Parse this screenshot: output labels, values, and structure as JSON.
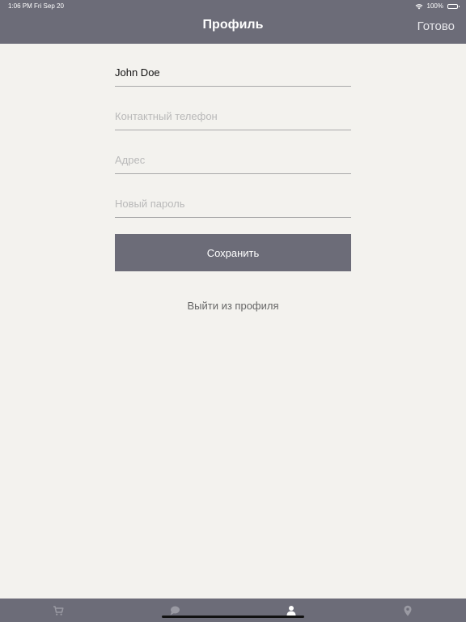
{
  "status_bar": {
    "time": "1:06 PM",
    "date": "Fri Sep 20",
    "battery": "100%",
    "icons": [
      "wifi-icon",
      "battery-icon"
    ]
  },
  "header": {
    "title": "Профиль",
    "done_label": "Готово"
  },
  "form": {
    "name": {
      "value": "John Doe",
      "placeholder": ""
    },
    "phone": {
      "value": "",
      "placeholder": "Контактный телефон"
    },
    "address": {
      "value": "",
      "placeholder": "Адрес"
    },
    "password": {
      "value": "",
      "placeholder": "Новый пароль"
    },
    "save_label": "Сохранить",
    "logout_label": "Выйти из профиля"
  },
  "tabbar": {
    "items": [
      {
        "icon": "cart-icon",
        "active": false
      },
      {
        "icon": "chat-icon",
        "active": false
      },
      {
        "icon": "profile-icon",
        "active": true
      },
      {
        "icon": "location-pin-icon",
        "active": false
      }
    ]
  },
  "colors": {
    "accent": "#6c6c78",
    "background": "#f3f2ee",
    "tab_inactive": "#9a9aa3",
    "tab_active": "#ffffff"
  }
}
